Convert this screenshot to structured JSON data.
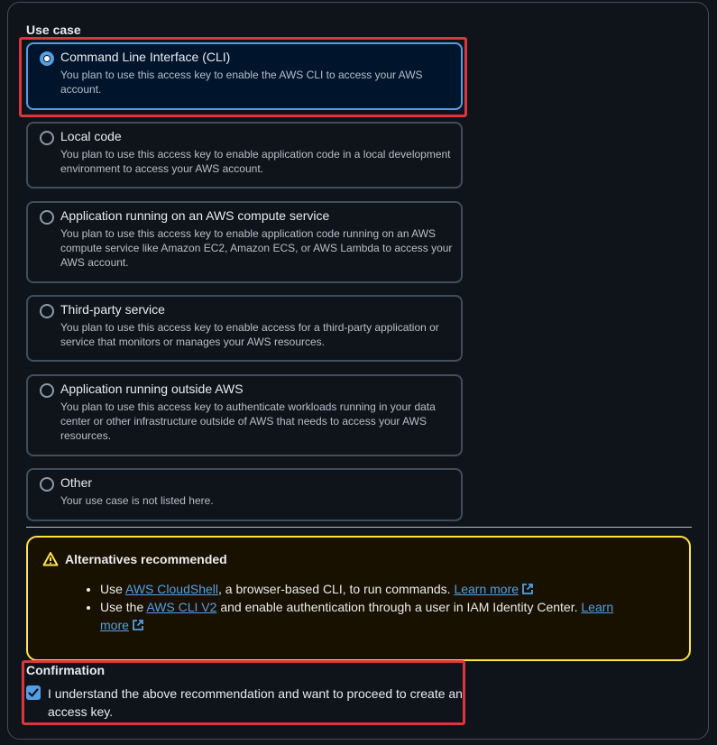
{
  "use_case": {
    "label": "Use case",
    "options": [
      {
        "title": "Command Line Interface (CLI)",
        "desc": "You plan to use this access key to enable the AWS CLI to access your AWS account.",
        "selected": true
      },
      {
        "title": "Local code",
        "desc": "You plan to use this access key to enable application code in a local development environment to access your AWS account.",
        "selected": false
      },
      {
        "title": "Application running on an AWS compute service",
        "desc": "You plan to use this access key to enable application code running on an AWS compute service like Amazon EC2, Amazon ECS, or AWS Lambda to access your AWS account.",
        "selected": false
      },
      {
        "title": "Third-party service",
        "desc": "You plan to use this access key to enable access for a third-party application or service that monitors or manages your AWS resources.",
        "selected": false
      },
      {
        "title": "Application running outside AWS",
        "desc": "You plan to use this access key to authenticate workloads running in your data center or other infrastructure outside of AWS that needs to access your AWS resources.",
        "selected": false
      },
      {
        "title": "Other",
        "desc": "Your use case is not listed here.",
        "selected": false
      }
    ]
  },
  "alert": {
    "title": "Alternatives recommended",
    "item1": {
      "prefix": "Use ",
      "link": "AWS CloudShell",
      "middle": ", a browser-based CLI, to run commands. ",
      "learn": "Learn more"
    },
    "item2": {
      "prefix": "Use the ",
      "link": "AWS CLI V2",
      "middle": " and enable authentication through a user in IAM Identity Center. ",
      "learn": "Learn more"
    },
    "icon": "warning-icon",
    "color": "#ffe347"
  },
  "confirmation": {
    "label": "Confirmation",
    "checkbox_text": "I understand the above recommendation and want to proceed to create an access key.",
    "checked": true
  },
  "colors": {
    "accent": "#539fe5",
    "highlight": "#d9363e"
  }
}
